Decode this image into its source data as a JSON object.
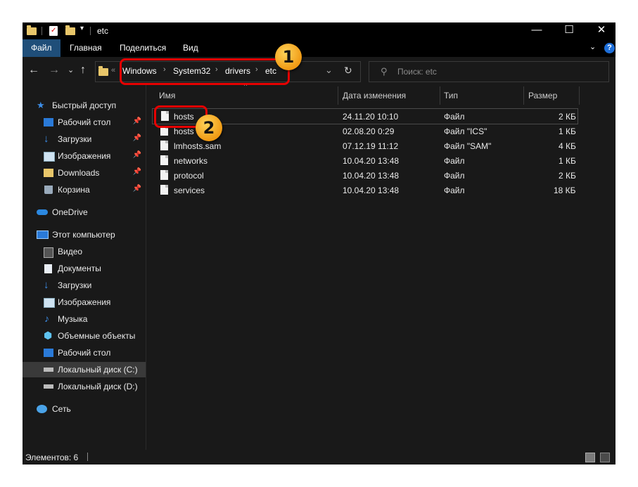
{
  "window": {
    "title": "etc",
    "controls": {
      "minimize": "—",
      "maximize": "☐",
      "close": "✕"
    }
  },
  "ribbon": {
    "tabs": [
      "Файл",
      "Главная",
      "Поделиться",
      "Вид"
    ],
    "active_tab": "Файл"
  },
  "address": {
    "overflow": "«",
    "crumbs": [
      "Windows",
      "System32",
      "drivers",
      "etc"
    ],
    "separator": "›",
    "refresh": "↻",
    "dropdown": "⌄"
  },
  "search": {
    "placeholder": "Поиск: etc"
  },
  "sidebar": {
    "quick_access": "Быстрый доступ",
    "quick_items": [
      "Рабочий стол",
      "Загрузки",
      "Изображения",
      "Downloads",
      "Корзина"
    ],
    "onedrive": "OneDrive",
    "this_pc": "Этот компьютер",
    "pc_items": [
      "Видео",
      "Документы",
      "Загрузки",
      "Изображения",
      "Музыка",
      "Объемные объекты",
      "Рабочий стол",
      "Локальный диск (C:)",
      "Локальный диск (D:)"
    ],
    "network": "Сеть"
  },
  "columns": {
    "name": "Имя",
    "modified": "Дата изменения",
    "type": "Тип",
    "size": "Размер"
  },
  "files": [
    {
      "name": "hosts",
      "modified": "24.11.20 10:10",
      "type": "Файл",
      "size": "2 КБ"
    },
    {
      "name": "hosts",
      "modified": "02.08.20 0:29",
      "type": "Файл \"ICS\"",
      "size": "1 КБ"
    },
    {
      "name": "lmhosts.sam",
      "modified": "07.12.19 11:12",
      "type": "Файл \"SAM\"",
      "size": "4 КБ"
    },
    {
      "name": "networks",
      "modified": "10.04.20 13:48",
      "type": "Файл",
      "size": "1 КБ"
    },
    {
      "name": "protocol",
      "modified": "10.04.20 13:48",
      "type": "Файл",
      "size": "2 КБ"
    },
    {
      "name": "services",
      "modified": "10.04.20 13:48",
      "type": "Файл",
      "size": "18 КБ"
    }
  ],
  "status": {
    "items_count": "Элементов: 6"
  },
  "annotations": {
    "badge1": "1",
    "badge2": "2"
  },
  "colors": {
    "accent_tab": "#1f4e79",
    "highlight": "#e60000",
    "badge": "#f09a14",
    "background": "#191919"
  }
}
